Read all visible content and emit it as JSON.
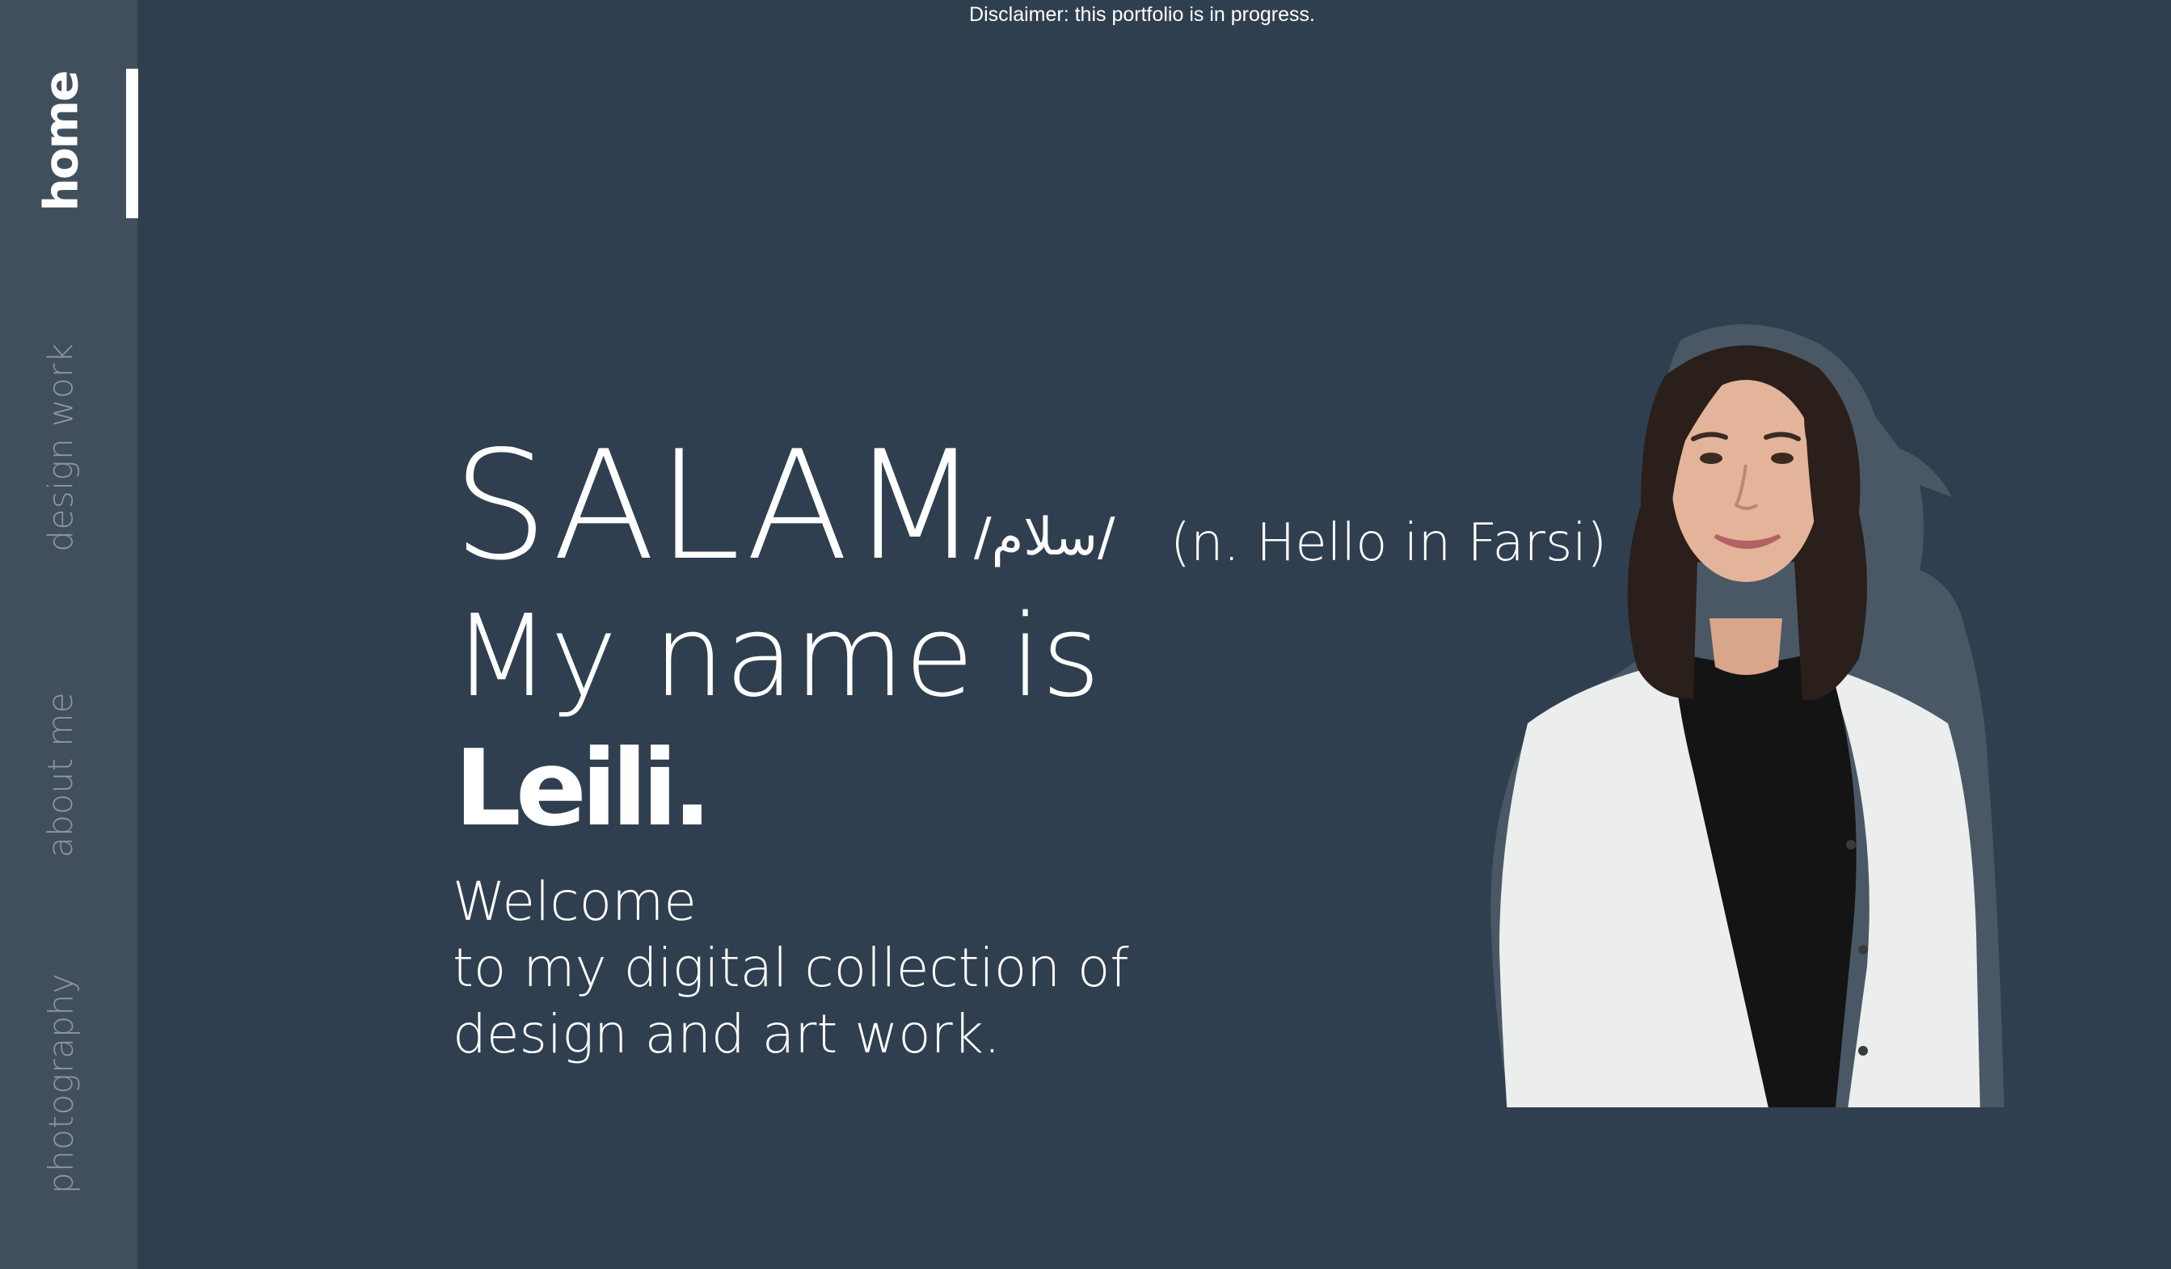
{
  "disclaimer": "Disclaimer: this portfolio is in progress.",
  "sidebar": {
    "items": [
      {
        "label": "home",
        "active": true
      },
      {
        "label": "design work",
        "active": false
      },
      {
        "label": "about me",
        "active": false
      },
      {
        "label": "photography",
        "active": false
      }
    ]
  },
  "hero": {
    "salam": "SALAM",
    "farsi": "/سلام/",
    "translation": "(n. Hello in Farsi)",
    "intro": "My name is",
    "name": "Leili.",
    "welcome_lines": [
      "Welcome",
      "to my digital collection of",
      "design and art work."
    ]
  },
  "colors": {
    "background": "#303f4f",
    "sidebar": "#414f5c",
    "text": "#ffffff",
    "inactive_nav": "#8c97a2"
  }
}
